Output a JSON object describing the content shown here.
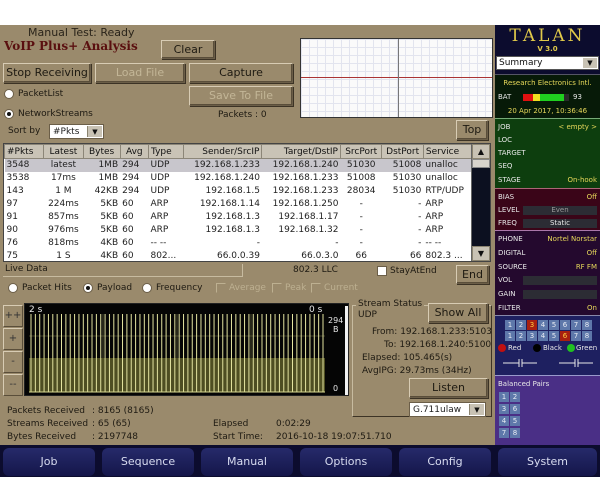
{
  "header": {
    "status": "Manual Test: Ready",
    "title": "VoIP Plus+ Analysis"
  },
  "buttons": {
    "clear": "Clear",
    "stop_receiving": "Stop Receiving",
    "load_file": "Load File",
    "capture": "Capture",
    "save_to_file": "Save To File",
    "top": "Top",
    "end": "End",
    "show_all": "Show All",
    "listen": "Listen"
  },
  "view_mode": {
    "options": [
      "PacketList",
      "NetworkStreams"
    ],
    "selected": "NetworkStreams"
  },
  "packets_label": "Packets : 0",
  "sort": {
    "label": "Sort by",
    "value": "#Pkts"
  },
  "table": {
    "columns": [
      "#Pkts",
      "Latest",
      "Bytes",
      "Avg",
      "Type",
      "Sender/SrcIP",
      "Target/DstIP",
      "SrcPort",
      "DstPort",
      "Service"
    ],
    "rows": [
      [
        "3548",
        "latest",
        "1MB",
        "294",
        "UDP",
        "192.168.1.233",
        "192.168.1.240",
        "51030",
        "51008",
        "unalloc"
      ],
      [
        "3538",
        "17ms",
        "1MB",
        "294",
        "UDP",
        "192.168.1.240",
        "192.168.1.233",
        "51008",
        "51030",
        "unalloc"
      ],
      [
        "143",
        "1 M",
        "42KB",
        "294",
        "UDP",
        "192.168.1.5",
        "192.168.1.233",
        "28034",
        "51030",
        "RTP/UDP"
      ],
      [
        "97",
        "224ms",
        "5KB",
        "60",
        "ARP",
        "192.168.1.14",
        "192.168.1.250",
        "-",
        "-",
        "ARP"
      ],
      [
        "91",
        "857ms",
        "5KB",
        "60",
        "ARP",
        "192.168.1.3",
        "192.168.1.17",
        "-",
        "-",
        "ARP"
      ],
      [
        "90",
        "976ms",
        "5KB",
        "60",
        "ARP",
        "192.168.1.3",
        "192.168.1.32",
        "-",
        "-",
        "ARP"
      ],
      [
        "76",
        "818ms",
        "4KB",
        "60",
        "-- --",
        "-",
        "-",
        "-",
        "-",
        "-- --"
      ],
      [
        "75",
        "1 S",
        "4KB",
        "60",
        "802...",
        "66.0.0.39",
        "66.0.3.0",
        "66",
        "66",
        "802.3 ..."
      ]
    ],
    "selected_row": 0
  },
  "live_data": {
    "label": "Live Data",
    "protocol": "802.3 LLC",
    "stay_at_end": "StayAtEnd"
  },
  "graph_mode": {
    "options": [
      "Packet Hits",
      "Payload",
      "Frequency"
    ],
    "selected": "Payload",
    "checks": [
      "Average",
      "Peak",
      "Current"
    ]
  },
  "zoom_buttons": [
    "++",
    "+",
    "-",
    "--"
  ],
  "waveform": {
    "left_time": "2 s",
    "right_time": "0 s",
    "max_label": "294",
    "unit_label": "B",
    "min_label": "0",
    "payload_bytes": 294
  },
  "stream_status": {
    "legend": "Stream Status",
    "protocol": "UDP",
    "from": "From: 192.168.1.233:5103",
    "to": "To: 192.168.1.240:5100",
    "elapsed": "Elapsed: 105.465(s)",
    "avg_ipg": "AvgIPG: 29.73ms (34Hz)",
    "codec": "G.711ulaw"
  },
  "stats": {
    "packets_label": "Packets Received",
    "packets_value": ": 8165 (8165)",
    "streams_label": "Streams Received",
    "streams_value": ": 65 (65)",
    "bytes_label": "Bytes Received",
    "bytes_value": ": 2197748",
    "elapsed_label": "Elapsed",
    "elapsed_value": "0:02:29",
    "start_label": "Start Time:",
    "start_value": "2016-10-18 19:07:51.710"
  },
  "sidebar": {
    "logo": "TALAN",
    "version": "V 3.0",
    "view": "Summary",
    "company": "Research Electronics Intl.",
    "battery_label": "BAT",
    "battery_value": "93",
    "datetime": "20 Apr 2017, 10:36:46",
    "job": {
      "label": "JOB",
      "value": "< empty >"
    },
    "loc": {
      "label": "LOC",
      "value": ""
    },
    "target": {
      "label": "TARGET",
      "value": ""
    },
    "seq": {
      "label": "SEQ",
      "value": ""
    },
    "stage": {
      "label": "STAGE",
      "value": "On-hook"
    },
    "bias": {
      "label": "BIAS",
      "value": "Off"
    },
    "level": {
      "label": "LEVEL",
      "value": "Even"
    },
    "freq": {
      "label": "FREQ",
      "value": "Static"
    },
    "phone": {
      "label": "PHONE",
      "value": "Nortel Norstar"
    },
    "digital": {
      "label": "DIGITAL",
      "value": "Off"
    },
    "source": {
      "label": "SOURCE",
      "value": "RF FM"
    },
    "vol": {
      "label": "VOL",
      "value": ""
    },
    "gain": {
      "label": "GAIN",
      "value": ""
    },
    "filter": {
      "label": "FILTER",
      "value": "On"
    },
    "pins_row1": [
      "1",
      "2",
      "3",
      "4",
      "5",
      "6",
      "7",
      "8"
    ],
    "pins_row1_active": "3",
    "pins_row2": [
      "1",
      "2",
      "3",
      "4",
      "5",
      "6",
      "7",
      "8"
    ],
    "pins_row2_active": "6",
    "leads": [
      "Red",
      "Black",
      "Green"
    ],
    "lead_colors": {
      "Red": "#c01010",
      "Black": "#000000",
      "Green": "#20c020"
    },
    "balanced_pairs_label": "Balanced Pairs",
    "balanced_pairs": [
      [
        "1",
        "2"
      ],
      [
        "3",
        "6"
      ],
      [
        "4",
        "5"
      ],
      [
        "7",
        "8"
      ]
    ]
  },
  "nav": [
    "Job",
    "Sequence",
    "Manual",
    "Options",
    "Config",
    "System"
  ]
}
